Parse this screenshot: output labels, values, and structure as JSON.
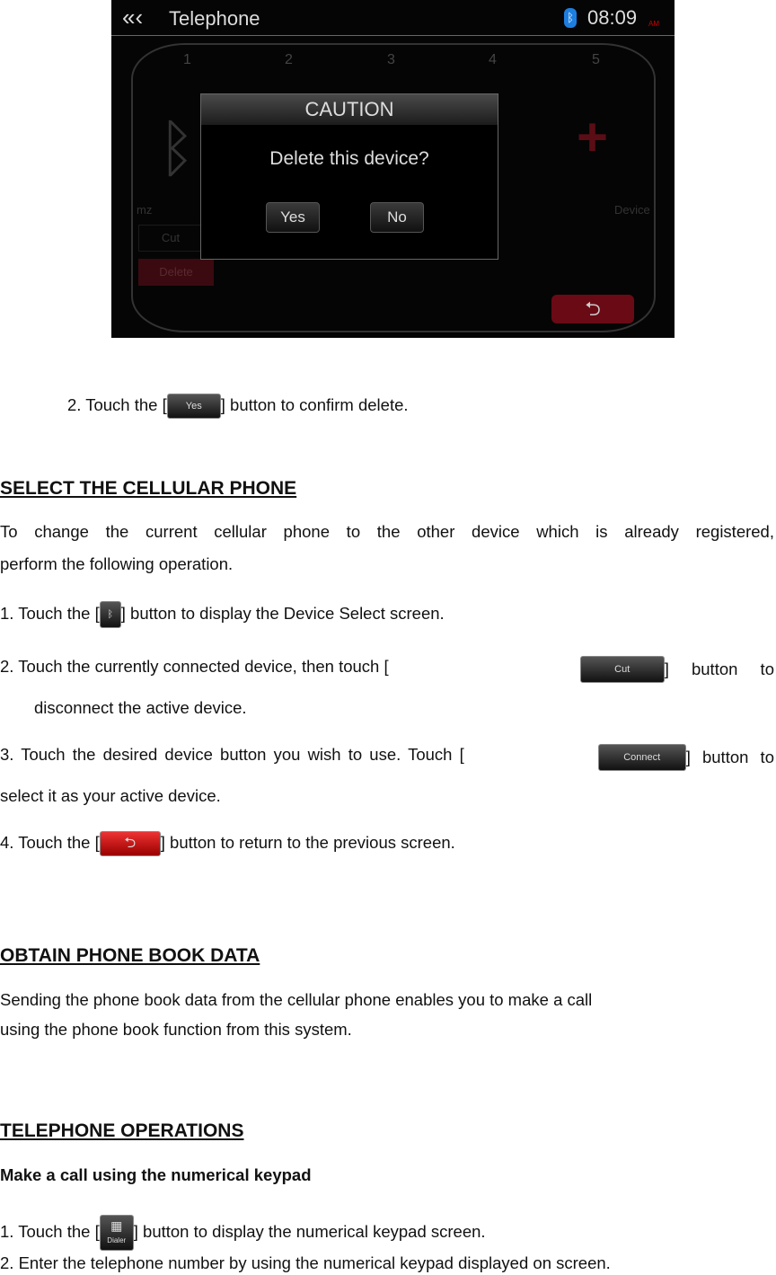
{
  "screen": {
    "back_icon": "triple-chevron-left-icon",
    "title": "Telephone",
    "bt_icon": "bluetooth-icon",
    "time": "08:09",
    "ampm": "AM",
    "slots": [
      "1",
      "2",
      "3",
      "4",
      "5"
    ],
    "device_name": "mz",
    "cut_label": "Cut",
    "delete_label": "Delete",
    "add_device_label": "Device",
    "dialog": {
      "title": "CAUTION",
      "message": "Delete this device?",
      "yes": "Yes",
      "no": "No"
    },
    "return_icon": "return-arrow-icon",
    "accent": "#b0112a"
  },
  "doc": {
    "step2_pre": "2.   Touch the [",
    "step2_btn": "Yes",
    "step2_post": "] button to confirm delete.",
    "h1": "SELECT THE CELLULAR PHONE",
    "p1a": "To change the current cellular phone to the other device which is already registered,",
    "p1b": "perform the following operation.",
    "s1_pre": "1.   Touch the [",
    "s1_post": "] button to display the Device Select screen.",
    "s2_pre": "2.   Touch the currently connected device, then touch [",
    "s2_btn": "Cut",
    "s2_post": "] button to",
    "s2b": "disconnect the active device.",
    "s3_pre": "3.    Touch the desired device button you wish to use. Touch [",
    "s3_btn": "Connect",
    "s3_post": "] button to",
    "s3b": "select it as your active device.",
    "s4_pre": "4.    Touch the [",
    "s4_post": "] button to return to the previous screen.",
    "h2": "OBTAIN PHONE BOOK DATA",
    "p2a": "Sending the phone book data from the cellular phone enables you to make a call",
    "p2b": "using the phone book function from this system.",
    "h3": "TELEPHONE OPERATIONS",
    "sub": "Make a call using the numerical keypad",
    "t1_pre": "1.   Touch the [",
    "t1_btn": "Dialer",
    "t1_post": "] button to display the numerical keypad screen.",
    "t2": "2.   Enter the telephone number by using the numerical keypad displayed on screen."
  }
}
